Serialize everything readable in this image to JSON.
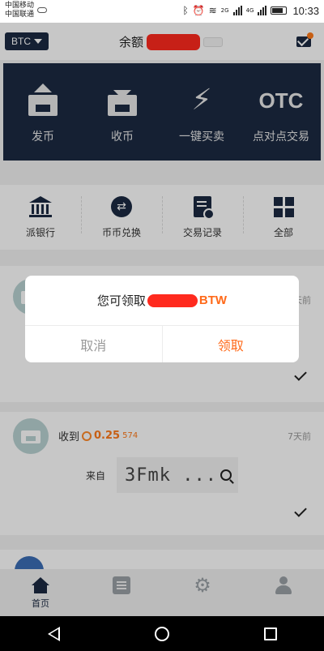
{
  "status_bar": {
    "carrier_1": "中国移动",
    "carrier_2": "中国联通",
    "network_1": "2G",
    "network_2": "4G",
    "time": "10:33",
    "icons": [
      "bluetooth-icon",
      "alarm-icon",
      "wifi-icon",
      "signal-icon",
      "battery-icon"
    ]
  },
  "header": {
    "currency": "BTC",
    "balance_label": "余额"
  },
  "actions": [
    {
      "label": "发币",
      "icon": "send-coin-icon"
    },
    {
      "label": "收币",
      "icon": "receive-coin-icon"
    },
    {
      "label": "一键买卖",
      "icon": "lightning-icon"
    },
    {
      "label": "点对点交易",
      "icon": "otc-icon",
      "icon_text": "OTC"
    }
  ],
  "menu": [
    {
      "label": "派银行",
      "icon": "bank-icon"
    },
    {
      "label": "币币兑换",
      "icon": "exchange-icon"
    },
    {
      "label": "交易记录",
      "icon": "record-icon"
    },
    {
      "label": "全部",
      "icon": "grid-icon"
    }
  ],
  "transactions": [
    {
      "time": "天前",
      "status": "check-icon"
    },
    {
      "title": "收到",
      "amount_main": "0.25",
      "amount_rest": "574",
      "time": "7天前",
      "from_label": "来自",
      "from_address": "3Fmk ...",
      "status": "check-icon"
    }
  ],
  "dialog": {
    "message_prefix": "您可领取",
    "coin": "BTW",
    "cancel_label": "取消",
    "confirm_label": "领取"
  },
  "tabbar": {
    "items": [
      {
        "label": "首页",
        "icon": "home-icon",
        "active": true
      },
      {
        "label": "",
        "icon": "list-icon",
        "active": false
      },
      {
        "label": "",
        "icon": "gear-icon",
        "active": false
      },
      {
        "label": "",
        "icon": "user-icon",
        "active": false
      }
    ]
  },
  "colors": {
    "navy": "#1b2a42",
    "accent": "#ff6a1a",
    "redaction": "#ff2a1e",
    "avatar": "#b9d2d2"
  }
}
